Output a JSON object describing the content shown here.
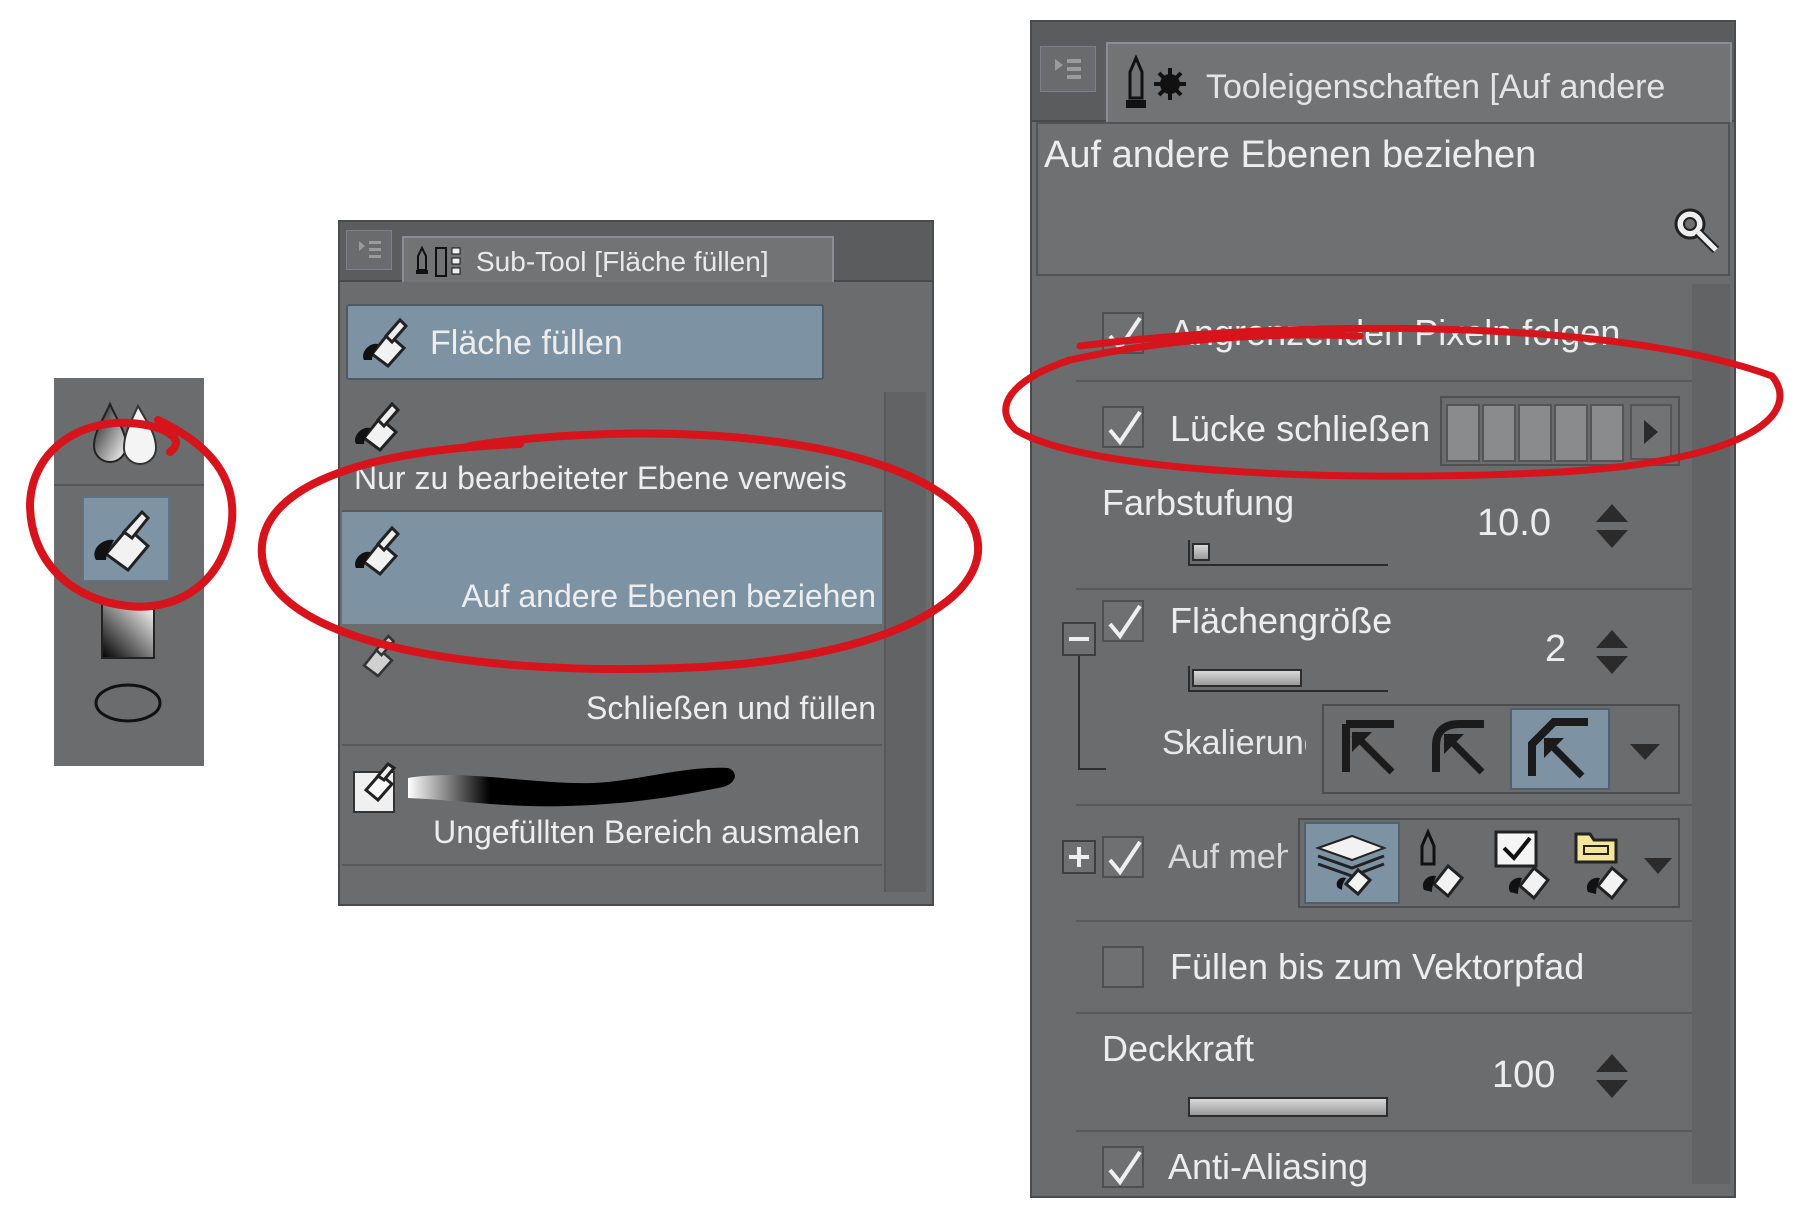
{
  "colors": {
    "panel_bg": "#6c6d6f",
    "selected_bg": "#7e93a4",
    "text": "#ededed",
    "annotation_red": "#d7131c"
  },
  "toolbar": {
    "icons": [
      "blend-drops-icon",
      "fill-bucket-icon",
      "gradient-icon",
      "ellipse-icon"
    ],
    "selected": "fill-bucket-icon"
  },
  "subtool": {
    "tab_title": "Sub-Tool [Fläche füllen]",
    "group_label": "Fläche füllen",
    "items": [
      {
        "label": "Nur zu bearbeiteter Ebene verweis",
        "selected": false
      },
      {
        "label": "Auf andere Ebenen beziehen",
        "selected": true
      },
      {
        "label": "Schließen und füllen",
        "selected": false
      },
      {
        "label": "Ungefüllten Bereich ausmalen",
        "selected": false
      }
    ]
  },
  "props": {
    "tab_title": "Tooleigenschaften [Auf andere",
    "tool_name": "Auf andere Ebenen beziehen",
    "follow_pixels": {
      "label": "Angrenzenden Pixeln folgen",
      "checked": true
    },
    "close_gap": {
      "label": "Lücke schließen",
      "checked": true,
      "level": 5,
      "max": 5
    },
    "color_margin": {
      "label": "Farbstufung",
      "value": "10.0"
    },
    "area_scaling": {
      "label": "Flächengröße",
      "value": "2",
      "checked": true
    },
    "scaling_mode": {
      "label": "Skalierung",
      "selected": 2
    },
    "multi_ref": {
      "label": "Auf meh",
      "checked": true
    },
    "fill_to_vector": {
      "label": "Füllen bis zum Vektorpfad",
      "checked": false
    },
    "opacity": {
      "label": "Deckkraft",
      "value": "100",
      "fraction": 1.0
    },
    "anti_alias": {
      "label": "Anti-Aliasing",
      "checked": true
    }
  }
}
